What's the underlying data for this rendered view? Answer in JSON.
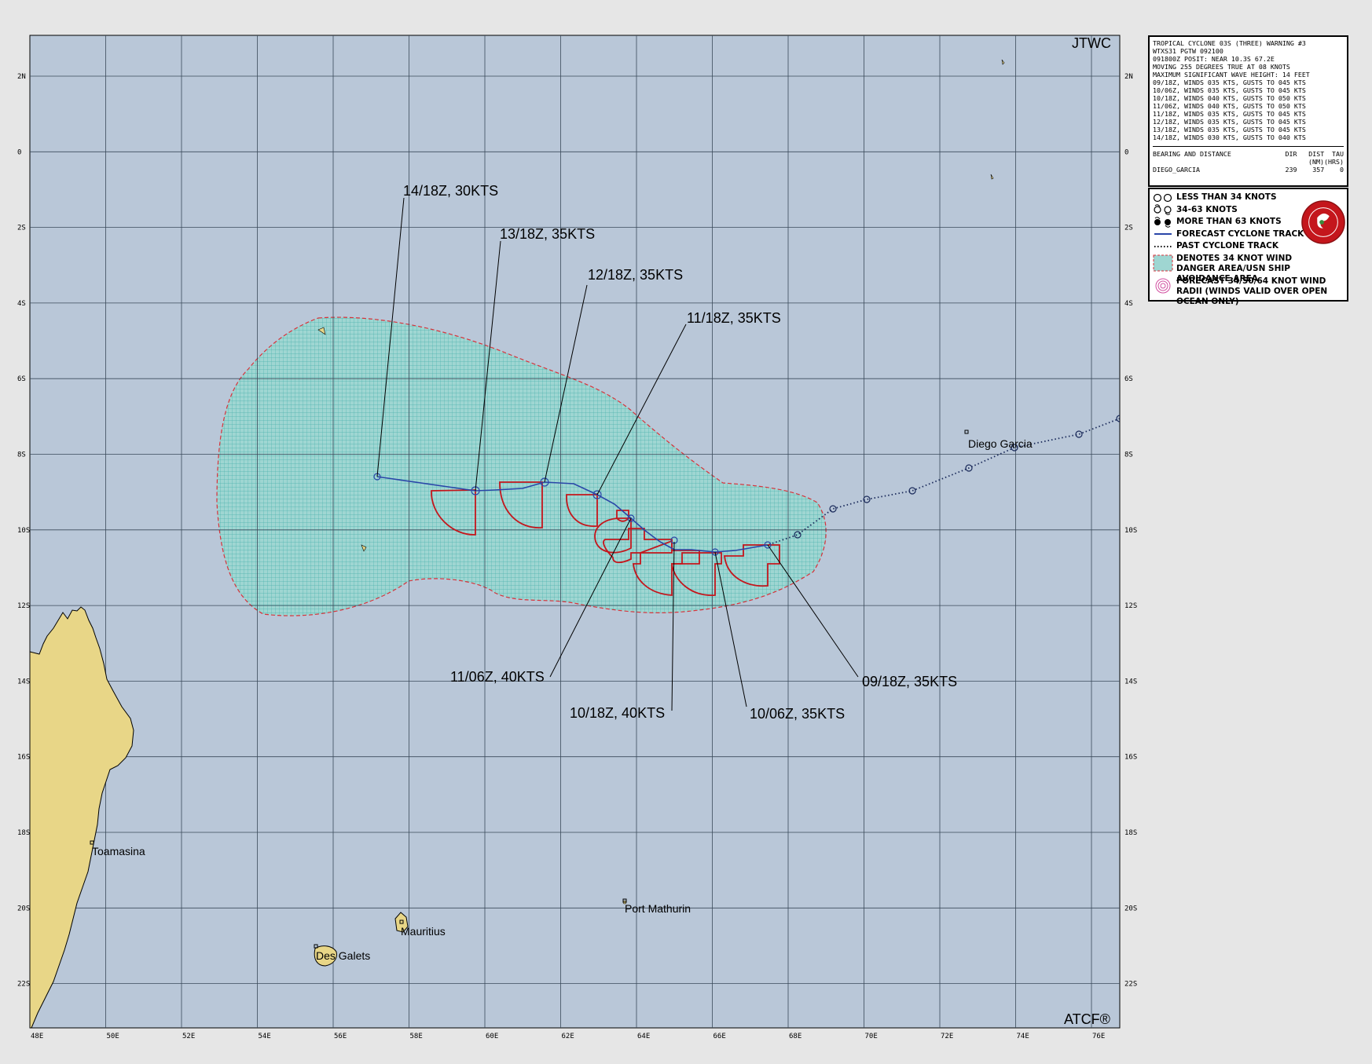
{
  "header": {
    "agency": "JTWC",
    "footer_brand": "ATCF®"
  },
  "info_box": {
    "lines": [
      "TROPICAL CYCLONE 03S (THREE) WARNING #3",
      "WTXS31 PGTW 092100",
      "091800Z POSIT: NEAR 10.3S 67.2E",
      "MOVING 255 DEGREES TRUE AT 08 KNOTS",
      "MAXIMUM SIGNIFICANT WAVE HEIGHT: 14 FEET",
      "09/18Z, WINDS 035 KTS, GUSTS TO 045 KTS",
      "10/06Z, WINDS 035 KTS, GUSTS TO 045 KTS",
      "10/18Z, WINDS 040 KTS, GUSTS TO 050 KTS",
      "11/06Z, WINDS 040 KTS, GUSTS TO 050 KTS",
      "11/18Z, WINDS 035 KTS, GUSTS TO 045 KTS",
      "12/18Z, WINDS 035 KTS, GUSTS TO 045 KTS",
      "13/18Z, WINDS 035 KTS, GUSTS TO 045 KTS",
      "14/18Z, WINDS 030 KTS, GUSTS TO 040 KTS"
    ],
    "bearing_header": {
      "label": "BEARING AND DISTANCE",
      "dir": "DIR",
      "dist": "DIST",
      "tau": "TAU",
      "dist_unit": "(NM)",
      "tau_unit": "(HRS)"
    },
    "bearing_row": {
      "name": "DIEGO_GARCIA",
      "dir": "239",
      "dist": "357",
      "tau": "0"
    }
  },
  "legend": {
    "items": [
      {
        "icon": "circle-icon",
        "label": "LESS THAN 34 KNOTS"
      },
      {
        "icon": "storm-icon",
        "label": "34-63 KNOTS"
      },
      {
        "icon": "filled-storm-icon",
        "label": "MORE THAN 63 KNOTS"
      },
      {
        "icon": "solid-line-icon",
        "label": "FORECAST CYCLONE TRACK"
      },
      {
        "icon": "dotted-line-icon",
        "label": "PAST CYCLONE TRACK"
      },
      {
        "icon": "hatched-area-icon",
        "label": "DENOTES 34 KNOT WIND DANGER AREA/USN SHIP AVOIDANCE AREA"
      },
      {
        "icon": "wind-radii-icon",
        "label": "FORECAST 34/50/64 KNOT WIND RADII (WINDS VALID OVER OPEN OCEAN ONLY)"
      }
    ]
  },
  "axes": {
    "lon_ticks": [
      "48E",
      "50E",
      "52E",
      "54E",
      "56E",
      "58E",
      "60E",
      "62E",
      "64E",
      "66E",
      "68E",
      "70E",
      "72E",
      "74E",
      "76E"
    ],
    "lat_ticks": [
      "2N",
      "0",
      "2S",
      "4S",
      "6S",
      "8S",
      "10S",
      "12S",
      "14S",
      "16S",
      "18S",
      "20S",
      "22S"
    ]
  },
  "forecast_labels": [
    {
      "id": "0918",
      "text": "09/18Z,  35KTS"
    },
    {
      "id": "1006",
      "text": "10/06Z,  35KTS"
    },
    {
      "id": "1018",
      "text": "10/18Z,  40KTS"
    },
    {
      "id": "1106",
      "text": "11/06Z,  40KTS"
    },
    {
      "id": "1118",
      "text": "11/18Z,  35KTS"
    },
    {
      "id": "1218",
      "text": "12/18Z,  35KTS"
    },
    {
      "id": "1318",
      "text": "13/18Z,  35KTS"
    },
    {
      "id": "1418",
      "text": "14/18Z,  30KTS"
    }
  ],
  "places": [
    "Diego Garcia",
    "Toamasina",
    "Port Mathurin",
    "Mauritius",
    "Des Galets"
  ],
  "colors": {
    "ocean": "#b9c7d8",
    "land": "#e8d687",
    "grid": "#3a4a5a",
    "danger_area": "#5fc8c4",
    "wind_radii": "#cc1a1a",
    "track": "#2a46a8"
  }
}
